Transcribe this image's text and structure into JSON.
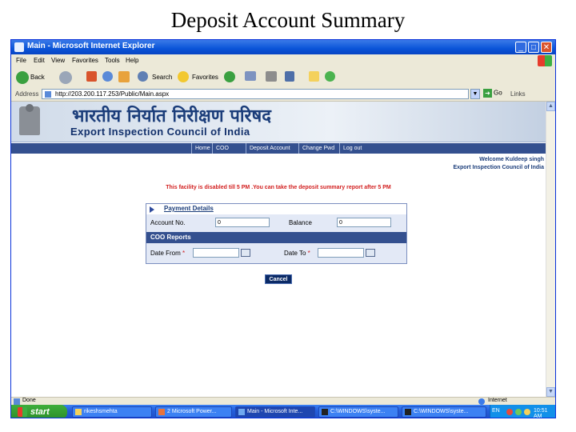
{
  "slide": {
    "title": "Deposit Account Summary"
  },
  "window": {
    "title": "Main - Microsoft Internet Explorer"
  },
  "menu": [
    "File",
    "Edit",
    "View",
    "Favorites",
    "Tools",
    "Help"
  ],
  "toolbar": {
    "back": "Back",
    "search": "Search",
    "favorites": "Favorites"
  },
  "address": {
    "label": "Address",
    "url": "http://203.200.117.253/Public/Main.aspx",
    "go": "Go",
    "links": "Links"
  },
  "banner": {
    "hindi": "भारतीय निर्यात निरीक्षण परिषद",
    "english": "Export Inspection Council of India"
  },
  "nav": [
    "Home",
    "COO",
    "Deposit Account",
    "Change Pwd",
    "Log out"
  ],
  "welcome": {
    "line1": "Welcome Kuldeep singh",
    "line2": "Export Inspection Council of India"
  },
  "message": "This facility is disabled till 5 PM .You can take the deposit summary report after 5 PM",
  "form": {
    "payment_heading": "Payment Details",
    "account_no_label": "Account No.",
    "account_no_value": "0",
    "balance_label": "Balance",
    "balance_value": "0",
    "coo_heading": "COO Reports",
    "date_from_label": "Date From",
    "date_to_label": "Date To",
    "required": "*",
    "cancel": "Cancel"
  },
  "status": {
    "text": "Done",
    "zone": "Internet"
  },
  "taskbar": {
    "start": "start",
    "tasks": [
      "rikeshsmehta",
      "2 Microsoft Power...",
      "Main - Microsoft Inte...",
      "C:\\WINDOWS\\syste...",
      "C:\\WINDOWS\\syste..."
    ],
    "lang": "EN",
    "clock": "10:51 AM"
  },
  "colors": {
    "nav_bg": "#34508f",
    "alert_red": "#d21f1f",
    "xp_blue": "#245edb"
  }
}
